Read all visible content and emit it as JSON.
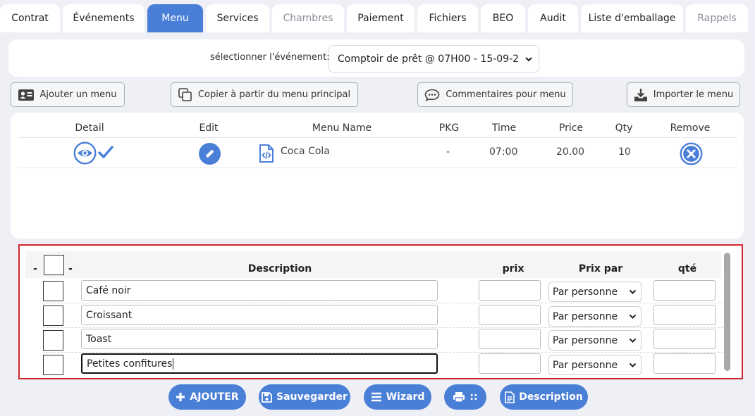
{
  "tabs": [
    {
      "label": "Contrat",
      "state": "normal"
    },
    {
      "label": "Événements",
      "state": "normal"
    },
    {
      "label": "Menu",
      "state": "active"
    },
    {
      "label": "Services",
      "state": "normal"
    },
    {
      "label": "Chambres",
      "state": "muted"
    },
    {
      "label": "Paiement",
      "state": "normal"
    },
    {
      "label": "Fichiers",
      "state": "normal"
    },
    {
      "label": "BEO",
      "state": "normal"
    },
    {
      "label": "Audit",
      "state": "normal"
    },
    {
      "label": "Liste d'emballage",
      "state": "normal"
    },
    {
      "label": "Rappels",
      "state": "muted"
    }
  ],
  "event": {
    "label": "sélectionner l'événement:",
    "selected": "Comptoir de prêt @ 07H00 - 15-09-2"
  },
  "actions": {
    "add_menu": "Ajouter un menu",
    "copy_main": "Copier à partir du menu principal",
    "comments": "Commentaires pour menu",
    "import": "Importer le menu"
  },
  "menu_table": {
    "headers": {
      "detail": "Detail",
      "edit": "Edit",
      "name": "Menu Name",
      "pkg": "PKG",
      "time": "Time",
      "price": "Price",
      "qty": "Qty",
      "remove": "Remove"
    },
    "rows": [
      {
        "name": "Coca Cola",
        "pkg": "-",
        "time": "07:00",
        "price": "20.00",
        "qty": "10"
      }
    ]
  },
  "items_table": {
    "headers": {
      "dash_left": "-",
      "dash_right": "-",
      "description": "Description",
      "price": "prix",
      "price_per": "Prix par",
      "qty": "qté"
    },
    "rows": [
      {
        "description": "Café noir",
        "price": "",
        "price_per": "Par personne",
        "qty": ""
      },
      {
        "description": "Croissant",
        "price": "",
        "price_per": "Par personne",
        "qty": ""
      },
      {
        "description": "Toast",
        "price": "",
        "price_per": "Par personne",
        "qty": ""
      },
      {
        "description": "Petites confitures",
        "price": "",
        "price_per": "Par personne",
        "qty": "",
        "focused": true
      }
    ]
  },
  "bottom_buttons": {
    "add": "AJOUTER",
    "save": "Sauvegarder",
    "wizard": "Wizard",
    "print": "::",
    "description": "Description"
  },
  "colors": {
    "accent": "#4a7fd8",
    "highlight_border": "#d1262f",
    "page_bg": "#eef0f5"
  }
}
